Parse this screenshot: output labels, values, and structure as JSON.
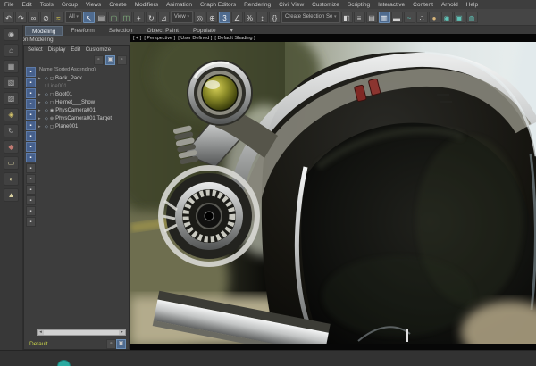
{
  "menubar": {
    "items": [
      "File",
      "Edit",
      "Tools",
      "Group",
      "Views",
      "Create",
      "Modifiers",
      "Animation",
      "Graph Editors",
      "Rendering",
      "Civil View",
      "Customize",
      "Scripting",
      "Interactive",
      "Content",
      "Arnold",
      "Help"
    ]
  },
  "toolbar": {
    "filter_dropdown": "All",
    "coord_dropdown": "View",
    "selection_set_dropdown": "Create Selection Se",
    "caret": "▾",
    "icons": [
      {
        "n": "undo",
        "g": "↶"
      },
      {
        "n": "redo",
        "g": "↷"
      },
      {
        "n": "select-and-link",
        "g": "∞"
      },
      {
        "n": "unlink-selection",
        "g": "⊘"
      },
      {
        "n": "bind-to-space-warp",
        "g": "≈"
      },
      {
        "n": "select-object",
        "g": "↖"
      },
      {
        "n": "select-by-name",
        "g": "▤"
      },
      {
        "n": "rectangular-selection-region",
        "g": "▢"
      },
      {
        "n": "window-crossing",
        "g": "◫"
      },
      {
        "n": "select-and-move",
        "g": "+"
      },
      {
        "n": "select-and-rotate",
        "g": "↻"
      },
      {
        "n": "select-and-scale",
        "g": "⊿"
      },
      {
        "n": "use-pivot-point-center",
        "g": "◎"
      },
      {
        "n": "select-and-manipulate",
        "g": "⊕"
      },
      {
        "n": "snaps-toggle",
        "g": "3"
      },
      {
        "n": "angle-snap",
        "g": "∠"
      },
      {
        "n": "percent-snap",
        "g": "%"
      },
      {
        "n": "spinner-snap",
        "g": "↕"
      },
      {
        "n": "edit-named-selection-sets",
        "g": "{}"
      },
      {
        "n": "mirror",
        "g": "◧"
      },
      {
        "n": "align",
        "g": "≡"
      },
      {
        "n": "toggle-layer-explorer",
        "g": "▤"
      },
      {
        "n": "toggle-scene-explorer",
        "g": "▥"
      },
      {
        "n": "toggle-ribbon",
        "g": "▬"
      },
      {
        "n": "curve-editor",
        "g": "~"
      },
      {
        "n": "schematic-view",
        "g": "∴"
      },
      {
        "n": "material-editor",
        "g": "●"
      },
      {
        "n": "render-setup",
        "g": "◉"
      },
      {
        "n": "rendered-frame-window",
        "g": "▣"
      },
      {
        "n": "render-production",
        "g": "◍"
      }
    ]
  },
  "ribbon": {
    "tabs": [
      {
        "label": "Modeling"
      },
      {
        "label": "Freeform"
      },
      {
        "label": "Selection"
      },
      {
        "label": "Object Paint"
      },
      {
        "label": "Populate"
      }
    ],
    "overflow": "▾",
    "panel_label": "Polygon Modeling"
  },
  "explorer": {
    "menus": [
      "Select",
      "Display",
      "Edit",
      "Customize"
    ],
    "column_header": "Name (Sorted Ascending)",
    "rows": [
      {
        "name": "Back_Pack"
      },
      {
        "name": "Line001"
      },
      {
        "name": "Boot01"
      },
      {
        "name": "Helmet___Show"
      },
      {
        "name": "PhysCamera001"
      },
      {
        "name": "PhysCamera001.Target"
      },
      {
        "name": "Plane001"
      }
    ],
    "scroll_left": "◂",
    "scroll_right": "▸",
    "footer_label": "Default"
  },
  "viewport": {
    "label_parts": [
      "[ + ]",
      "[ Perspective ]",
      "[ User Defined ]",
      "[ Default Shading ]"
    ]
  },
  "colors": {
    "accent_blue": "#4f6b8f",
    "footer_yellow": "#c9d34b",
    "active_viewport_border": "#7a7a35",
    "indicator_red": "#802824"
  }
}
